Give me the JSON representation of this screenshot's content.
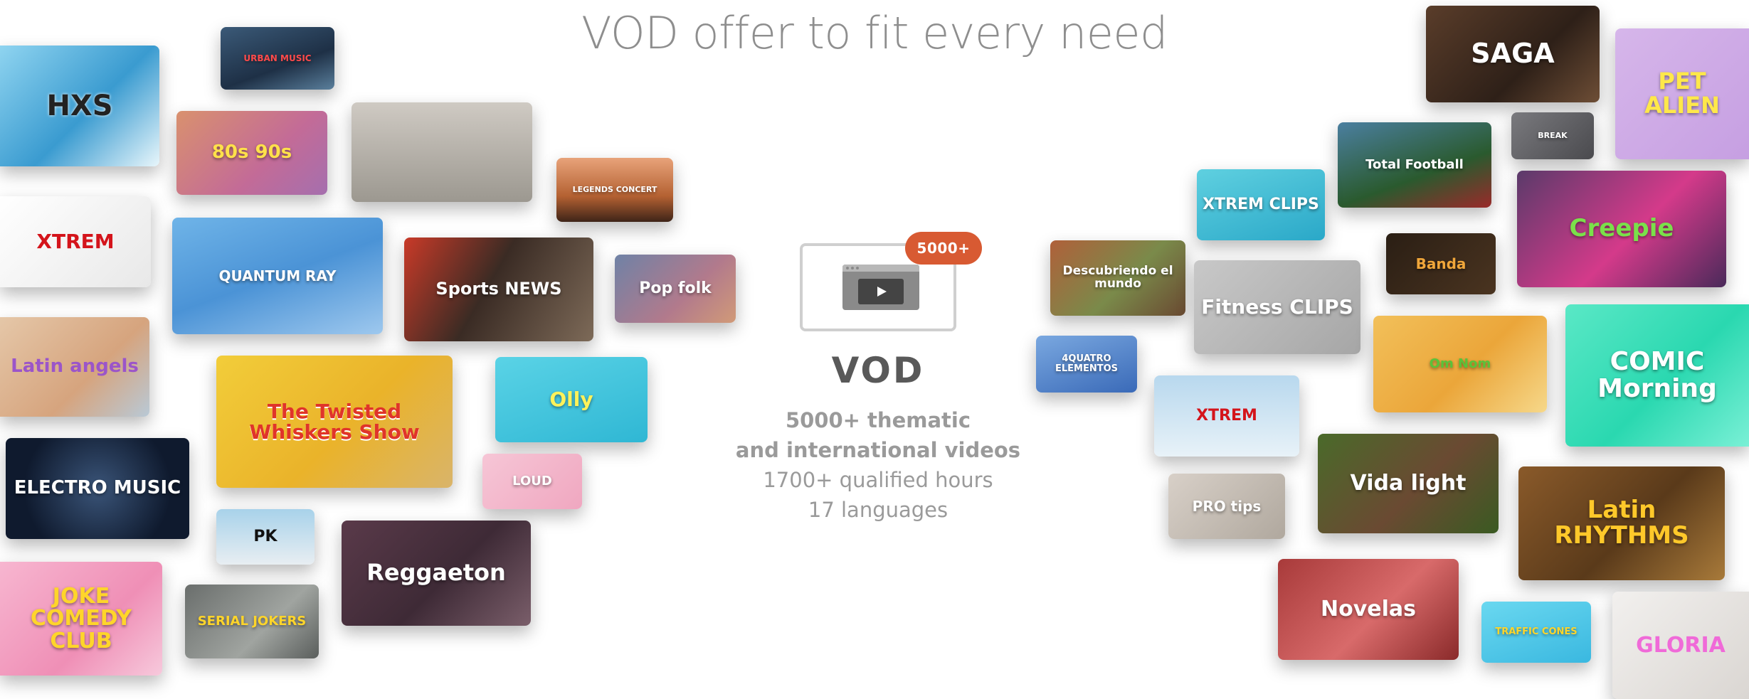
{
  "title": "VOD offer to fit every need",
  "colors": {
    "accent": "#d85a32",
    "title": "#8e8e8e",
    "label": "#595959",
    "text": "#9a9a9a"
  },
  "center": {
    "icon": "video-player-icon",
    "badge": "5000+",
    "label": "VOD",
    "lines": [
      "5000+ thematic",
      "and international videos",
      "1700+ qualified hours",
      "17 languages"
    ]
  },
  "tiles": [
    {
      "name": "hxs",
      "label": "HXS"
    },
    {
      "name": "urban-music",
      "label": "URBAN MUSIC"
    },
    {
      "name": "80s-90s",
      "label": "80s 90s"
    },
    {
      "name": "legendary-concert",
      "label": "LEGENDS CONCERT"
    },
    {
      "name": "xtreme-tricks",
      "label": "XTREM"
    },
    {
      "name": "quantum-ray",
      "label": "QUANTUM RAY"
    },
    {
      "name": "sports-news",
      "label": "Sports NEWS"
    },
    {
      "name": "pop-folk",
      "label": "Pop folk"
    },
    {
      "name": "latin-angels",
      "label": "Latin angels"
    },
    {
      "name": "twisted-whiskers",
      "label": "The Twisted Whiskers Show"
    },
    {
      "name": "olly-the-dolphin",
      "label": "Olly"
    },
    {
      "name": "electro-music",
      "label": "ELECTRO MUSIC"
    },
    {
      "name": "laughing-out-loud",
      "label": "LOUD"
    },
    {
      "name": "pk",
      "label": "PK"
    },
    {
      "name": "reggaeton",
      "label": "Reggaeton"
    },
    {
      "name": "joke-comedy-club",
      "label": "JOKE COMEDY CLUB"
    },
    {
      "name": "serial-jokers",
      "label": "SERIAL JOKERS"
    },
    {
      "name": "saga",
      "label": "SAGA"
    },
    {
      "name": "pet-alien",
      "label": "PET ALIEN"
    },
    {
      "name": "total-football",
      "label": "Total Football"
    },
    {
      "name": "breakdance",
      "label": "BREAK"
    },
    {
      "name": "xtrem-clips",
      "label": "XTREM CLIPS"
    },
    {
      "name": "creepie",
      "label": "Creepie"
    },
    {
      "name": "descubriendo-el-mundo",
      "label": "Descubriendo el mundo"
    },
    {
      "name": "fitness-clips",
      "label": "Fitness CLIPS"
    },
    {
      "name": "banda",
      "label": "Banda"
    },
    {
      "name": "4quatro-elementos",
      "label": "4QUATRO ELEMENTOS"
    },
    {
      "name": "om-nom",
      "label": "Om Nom"
    },
    {
      "name": "comic-morning",
      "label": "COMIC Morning"
    },
    {
      "name": "xtrem-ski",
      "label": "XTREM"
    },
    {
      "name": "vida-light",
      "label": "Vida light"
    },
    {
      "name": "pro-tips",
      "label": "PRO tips"
    },
    {
      "name": "latin-rhythms",
      "label": "Latin RHYTHMS"
    },
    {
      "name": "novelas",
      "label": "Novelas"
    },
    {
      "name": "traffic-cones",
      "label": "TRAFFIC CONES"
    },
    {
      "name": "gloria",
      "label": "GLORIA"
    }
  ]
}
